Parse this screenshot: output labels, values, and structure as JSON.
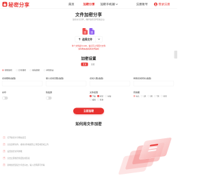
{
  "colors": {
    "accent": "#e8312f",
    "file_icon_red": "#ef4b4b",
    "file_icon_purple": "#8e5cf0"
  },
  "header": {
    "logo_text": "秘密分享",
    "nav": [
      {
        "label": "首页",
        "active": false
      },
      {
        "label": "加密分享",
        "active": true
      },
      {
        "label": "加密手机端",
        "active": false
      },
      {
        "label": "注册账号",
        "active": false
      }
    ],
    "login_label": "登录注册"
  },
  "hero": {
    "title": "文件加密分享",
    "subtitle": "加密分享文件，保护您的文件隐私安全"
  },
  "upload": {
    "select_label": "选择文件",
    "notes": [
      "单个文件最大1GB，会员可上传更大文件",
      "支持所有格式的文件加密"
    ]
  },
  "settings": {
    "title": "加密设置",
    "tabs": [
      {
        "label": "普通",
        "selected": true
      },
      {
        "label": "高级",
        "selected": false
      }
    ],
    "modes": [
      {
        "label": "密码加密",
        "checked": true
      },
      {
        "label": "口令加密",
        "checked": false
      },
      {
        "label": "链接加密",
        "checked": false
      },
      {
        "label": "手机验证",
        "checked": false
      }
    ],
    "fields": [
      {
        "label": "访问密码(选填)"
      },
      {
        "label": "单人访问次数(选填)"
      },
      {
        "label": "访问人数(选填)"
      },
      {
        "label": "有效访问时长(选填)"
      }
    ],
    "watermark": {
      "label": "水印",
      "enabled": false
    },
    "anti_screenshot": {
      "label": "防截屏",
      "enabled": false
    },
    "permissions": {
      "label": "文件权限",
      "options": [
        {
          "label": "下载",
          "checked": true
        },
        {
          "label": "打印",
          "checked": true
        },
        {
          "label": "复制",
          "checked": false
        },
        {
          "label": "编辑",
          "checked": false
        },
        {
          "label": "转发",
          "checked": false
        }
      ]
    },
    "validity": {
      "label": "有效期",
      "options": [
        {
          "label": "永久",
          "checked": true
        },
        {
          "label": "1天",
          "checked": false
        },
        {
          "label": "3天",
          "checked": false
        },
        {
          "label": "7天",
          "checked": false
        },
        {
          "label": "30天",
          "checked": false
        }
      ]
    },
    "submit_label": "立即加密"
  },
  "howto": {
    "title": "如何用文件加密",
    "steps": [
      {
        "num": "1",
        "text": "打开秘密分享网站首页"
      },
      {
        "num": "2",
        "text": "点击选择文件，或将文件拖拽到上传区域完成上传"
      },
      {
        "num": "3",
        "text": "设置加密访问参数"
      },
      {
        "num": "4",
        "text": "点击立即加密按钮生成链接"
      },
      {
        "num": "5",
        "text": "复制加密链接分享给好友，输入密码即可查看"
      }
    ]
  }
}
